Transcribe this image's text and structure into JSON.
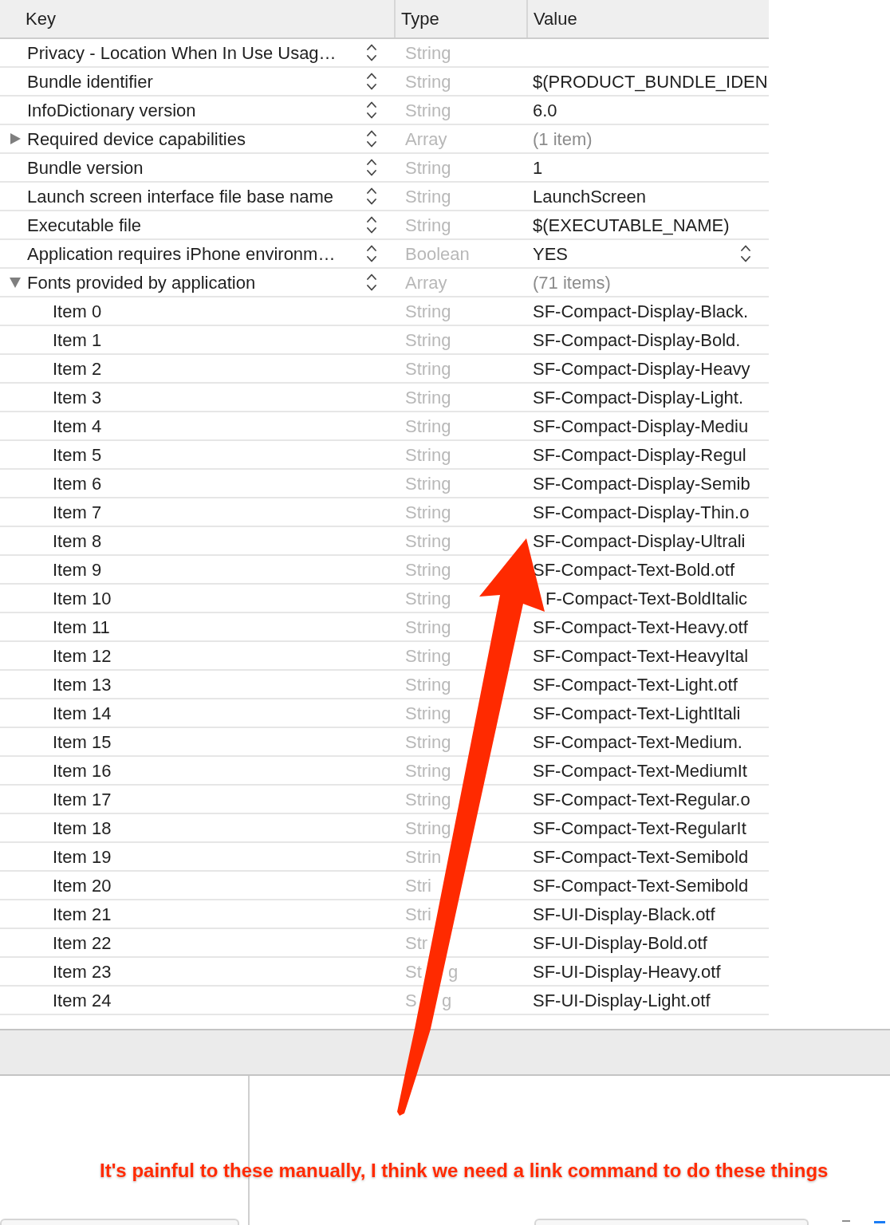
{
  "table": {
    "columns": [
      "Key",
      "Type",
      "Value"
    ],
    "rows": [
      {
        "key": "Privacy - Location When In Use Usag…",
        "type": "String",
        "kind": "string"
      },
      {
        "key": "Bundle identifier",
        "type": "String",
        "value": "$(PRODUCT_BUNDLE_IDEN",
        "kind": "string"
      },
      {
        "key": "InfoDictionary version",
        "type": "String",
        "value": "6.0",
        "kind": "string"
      },
      {
        "key": "Required device capabilities",
        "type": "Array",
        "value": "(1 item)",
        "kind": "array",
        "expanded": false
      },
      {
        "key": "Bundle version",
        "type": "String",
        "value": "1",
        "kind": "string"
      },
      {
        "key": "Launch screen interface file base name",
        "type": "String",
        "value": "LaunchScreen",
        "kind": "string"
      },
      {
        "key": "Executable file",
        "type": "String",
        "value": "$(EXECUTABLE_NAME)",
        "kind": "string"
      },
      {
        "key": "Application requires iPhone environm…",
        "type": "Boolean",
        "value": "YES",
        "kind": "boolean"
      },
      {
        "key": "Fonts provided by application",
        "type": "Array",
        "value": "(71 items)",
        "kind": "array",
        "expanded": true,
        "children": [
          {
            "key": "Item 0",
            "type": "String",
            "value": "SF-Compact-Display-Black."
          },
          {
            "key": "Item 1",
            "type": "String",
            "value": "SF-Compact-Display-Bold."
          },
          {
            "key": "Item 2",
            "type": "String",
            "value": "SF-Compact-Display-Heavy"
          },
          {
            "key": "Item 3",
            "type": "String",
            "value": "SF-Compact-Display-Light."
          },
          {
            "key": "Item 4",
            "type": "String",
            "value": "SF-Compact-Display-Mediu"
          },
          {
            "key": "Item 5",
            "type": "String",
            "value": "SF-Compact-Display-Regul"
          },
          {
            "key": "Item 6",
            "type": "String",
            "value": "SF-Compact-Display-Semib"
          },
          {
            "key": "Item 7",
            "type": "String",
            "value": "SF-Compact-Display-Thin.o"
          },
          {
            "key": "Item 8",
            "type": "String",
            "value": "SF-Compact-Display-Ultrali"
          },
          {
            "key": "Item 9",
            "type": "String",
            "value": "SF-Compact-Text-Bold.otf"
          },
          {
            "key": "Item 10",
            "type": "String",
            "value": "F-Compact-Text-BoldItalic"
          },
          {
            "key": "Item 11",
            "type": "String",
            "value": "SF-Compact-Text-Heavy.otf"
          },
          {
            "key": "Item 12",
            "type": "String",
            "value": "SF-Compact-Text-HeavyItal"
          },
          {
            "key": "Item 13",
            "type": "String",
            "value": "SF-Compact-Text-Light.otf"
          },
          {
            "key": "Item 14",
            "type": "String",
            "value": "SF-Compact-Text-LightItali"
          },
          {
            "key": "Item 15",
            "type": "String",
            "value": "SF-Compact-Text-Medium."
          },
          {
            "key": "Item 16",
            "type": "String",
            "value": "SF-Compact-Text-MediumIt"
          },
          {
            "key": "Item 17",
            "type": "String",
            "value": "SF-Compact-Text-Regular.o"
          },
          {
            "key": "Item 18",
            "type": "String",
            "value": "SF-Compact-Text-RegularIt"
          },
          {
            "key": "Item 19",
            "type": "Strin",
            "value": "SF-Compact-Text-Semibold"
          },
          {
            "key": "Item 20",
            "type": "Stri",
            "value": "SF-Compact-Text-Semibold"
          },
          {
            "key": "Item 21",
            "type": "Stri",
            "value": "SF-UI-Display-Black.otf"
          },
          {
            "key": "Item 22",
            "type": "Str",
            "value": "SF-UI-Display-Bold.otf"
          },
          {
            "key": "Item 23",
            "type": "St",
            "type_tail": "g",
            "value": "SF-UI-Display-Heavy.otf"
          },
          {
            "key": "Item 24",
            "type": "S",
            "type_tail": "g",
            "value": "SF-UI-Display-Light.otf"
          }
        ]
      }
    ]
  },
  "annotation": {
    "text": "It's painful to these manually, I think we need a link command to do these things"
  }
}
